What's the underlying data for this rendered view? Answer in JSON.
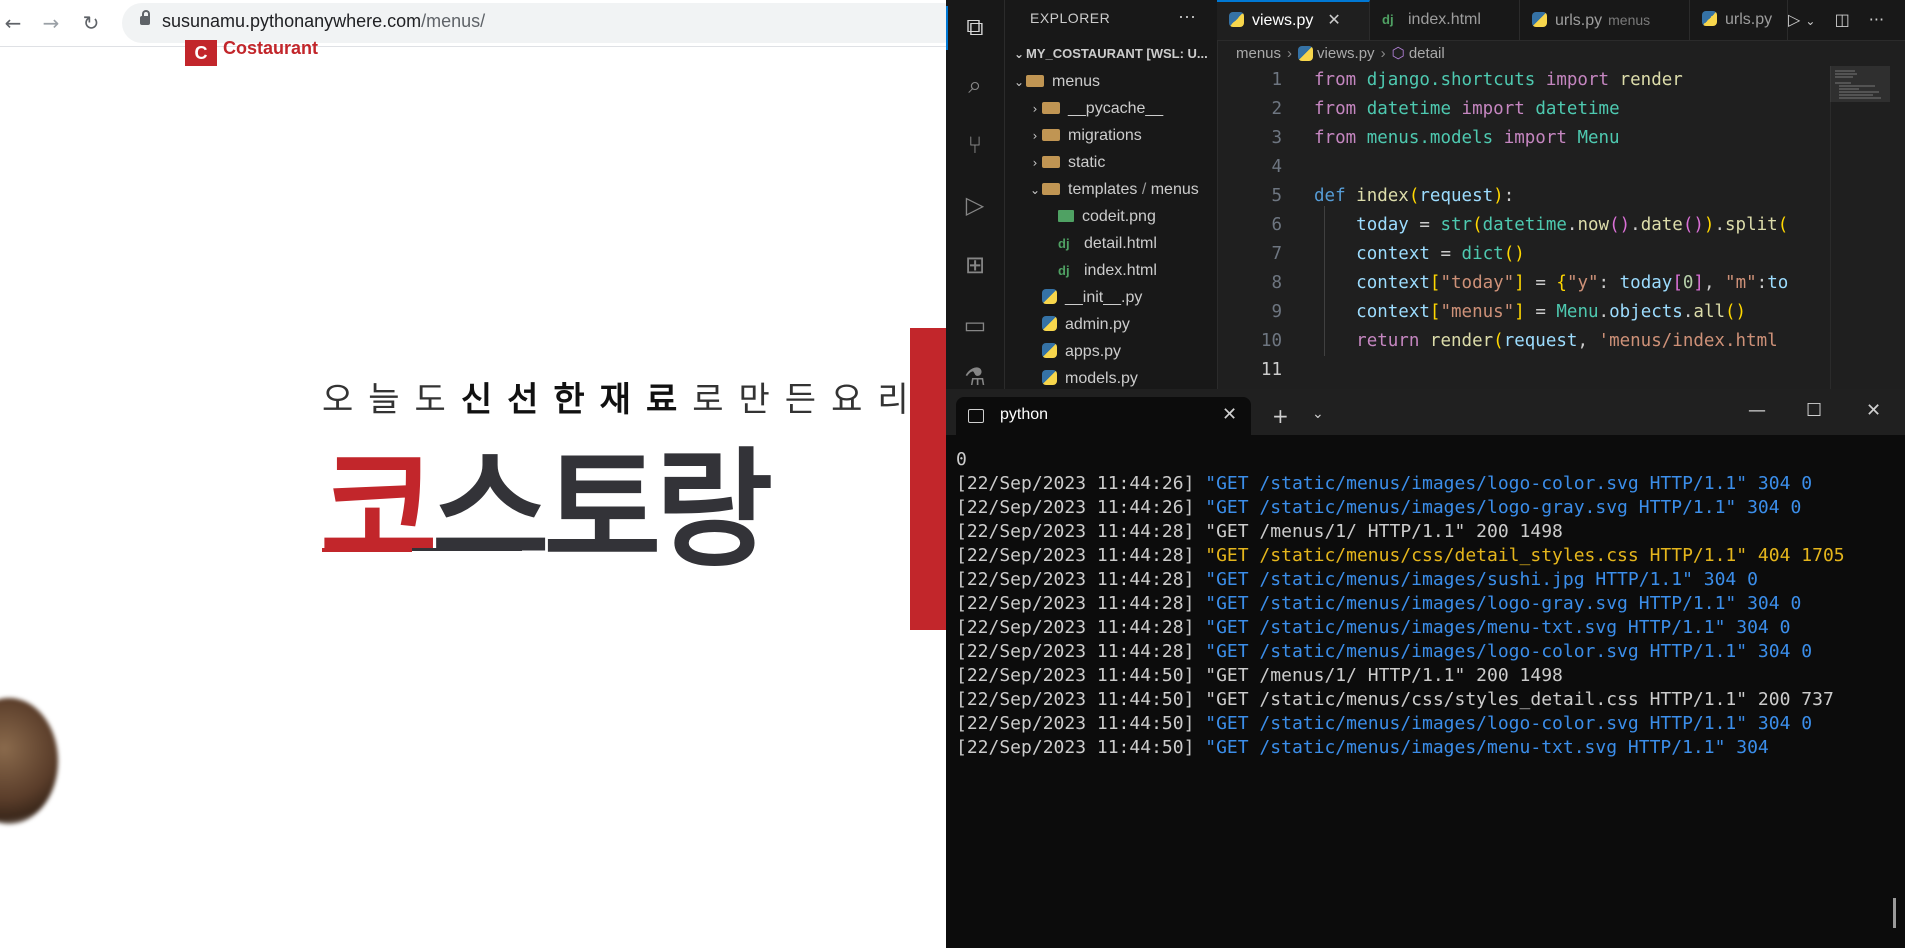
{
  "browser": {
    "nav": {
      "back": "←",
      "forward": "→",
      "reload": "↻"
    },
    "url_host": "susunamu.pythonanywhere.com",
    "url_path": "/menus/",
    "page": {
      "logo_mark": "C",
      "logo_word": "Costaurant",
      "tagline_light_1": "오늘도",
      "tagline_bold": "신선한재료",
      "tagline_light_2": "로만든요리",
      "hero_first": "코",
      "hero_rest": "스토랑"
    }
  },
  "vscode": {
    "explorer_title": "EXPLORER",
    "explorer_more": "···",
    "workspace": "MY_COSTAURANT [WSL: U...",
    "tree": [
      {
        "label": "menus",
        "kind": "folder",
        "open": true,
        "depth": 0
      },
      {
        "label": "__pycache__",
        "kind": "folder",
        "open": false,
        "depth": 1
      },
      {
        "label": "migrations",
        "kind": "folder",
        "open": false,
        "depth": 1
      },
      {
        "label": "static",
        "kind": "folder",
        "open": false,
        "depth": 1
      },
      {
        "label": "templates",
        "label_suffix": "menus",
        "kind": "folder",
        "open": true,
        "depth": 1
      },
      {
        "label": "codeit.png",
        "kind": "png",
        "depth": 2
      },
      {
        "label": "detail.html",
        "kind": "dj",
        "depth": 2
      },
      {
        "label": "index.html",
        "kind": "dj",
        "depth": 2
      },
      {
        "label": "__init__.py",
        "kind": "py",
        "depth": 1
      },
      {
        "label": "admin.py",
        "kind": "py",
        "depth": 1
      },
      {
        "label": "apps.py",
        "kind": "py",
        "depth": 1
      },
      {
        "label": "models.py",
        "kind": "py",
        "depth": 1
      }
    ],
    "tabs": [
      {
        "label": "views.py",
        "desc": "",
        "icon": "python-icon",
        "active": true
      },
      {
        "label": "index.html",
        "desc": "",
        "icon": "django-icon",
        "active": false
      },
      {
        "label": "urls.py",
        "desc": "menus",
        "icon": "python-icon",
        "active": false
      },
      {
        "label": "urls.py",
        "desc": "",
        "icon": "python-icon",
        "active": false
      }
    ],
    "tab_close": "✕",
    "breadcrumbs": {
      "folder": "menus",
      "file": "views.py",
      "symbol": "detail"
    },
    "code_lines": [
      [
        [
          "k-kw",
          "from"
        ],
        [
          "k-plain",
          " "
        ],
        [
          "k-cls",
          "django.shortcuts"
        ],
        [
          "k-plain",
          " "
        ],
        [
          "k-kw",
          "import"
        ],
        [
          "k-plain",
          " "
        ],
        [
          "k-fn",
          "render"
        ]
      ],
      [
        [
          "k-kw",
          "from"
        ],
        [
          "k-plain",
          " "
        ],
        [
          "k-cls",
          "datetime"
        ],
        [
          "k-plain",
          " "
        ],
        [
          "k-kw",
          "import"
        ],
        [
          "k-plain",
          " "
        ],
        [
          "k-cls",
          "datetime"
        ]
      ],
      [
        [
          "k-kw",
          "from"
        ],
        [
          "k-plain",
          " "
        ],
        [
          "k-cls",
          "menus.models"
        ],
        [
          "k-plain",
          " "
        ],
        [
          "k-kw",
          "import"
        ],
        [
          "k-plain",
          " "
        ],
        [
          "k-cls",
          "Menu"
        ]
      ],
      [],
      [
        [
          "k-def",
          "def"
        ],
        [
          "k-plain",
          " "
        ],
        [
          "k-fn",
          "index"
        ],
        [
          "k-br1",
          "("
        ],
        [
          "k-var",
          "request"
        ],
        [
          "k-br1",
          ")"
        ],
        [
          "k-plain",
          ":"
        ]
      ],
      [
        [
          "k-plain",
          "    "
        ],
        [
          "k-var",
          "today"
        ],
        [
          "k-plain",
          " = "
        ],
        [
          "k-cls",
          "str"
        ],
        [
          "k-br1",
          "("
        ],
        [
          "k-cls",
          "datetime"
        ],
        [
          "k-plain",
          "."
        ],
        [
          "k-fn",
          "now"
        ],
        [
          "k-br2",
          "()"
        ],
        [
          "k-plain",
          "."
        ],
        [
          "k-fn",
          "date"
        ],
        [
          "k-br2",
          "()"
        ],
        [
          "k-br1",
          ")"
        ],
        [
          "k-plain",
          "."
        ],
        [
          "k-fn",
          "split"
        ],
        [
          "k-br1",
          "("
        ]
      ],
      [
        [
          "k-plain",
          "    "
        ],
        [
          "k-var",
          "context"
        ],
        [
          "k-plain",
          " = "
        ],
        [
          "k-cls",
          "dict"
        ],
        [
          "k-br1",
          "()"
        ]
      ],
      [
        [
          "k-plain",
          "    "
        ],
        [
          "k-var",
          "context"
        ],
        [
          "k-br1",
          "["
        ],
        [
          "k-str",
          "\"today\""
        ],
        [
          "k-br1",
          "]"
        ],
        [
          "k-plain",
          " = "
        ],
        [
          "k-br1",
          "{"
        ],
        [
          "k-str",
          "\"y\""
        ],
        [
          "k-plain",
          ": "
        ],
        [
          "k-var",
          "today"
        ],
        [
          "k-br2",
          "["
        ],
        [
          "k-num",
          "0"
        ],
        [
          "k-br2",
          "]"
        ],
        [
          "k-plain",
          ", "
        ],
        [
          "k-str",
          "\"m\""
        ],
        [
          "k-plain",
          ":"
        ],
        [
          "k-var",
          "to"
        ]
      ],
      [
        [
          "k-plain",
          "    "
        ],
        [
          "k-var",
          "context"
        ],
        [
          "k-br1",
          "["
        ],
        [
          "k-str",
          "\"menus\""
        ],
        [
          "k-br1",
          "]"
        ],
        [
          "k-plain",
          " = "
        ],
        [
          "k-cls",
          "Menu"
        ],
        [
          "k-plain",
          "."
        ],
        [
          "k-var",
          "objects"
        ],
        [
          "k-plain",
          "."
        ],
        [
          "k-fn",
          "all"
        ],
        [
          "k-br1",
          "()"
        ]
      ],
      [
        [
          "k-plain",
          "    "
        ],
        [
          "k-kw",
          "return"
        ],
        [
          "k-plain",
          " "
        ],
        [
          "k-fn",
          "render"
        ],
        [
          "k-br1",
          "("
        ],
        [
          "k-var",
          "request"
        ],
        [
          "k-plain",
          ", "
        ],
        [
          "k-str",
          "'menus/index.html"
        ]
      ],
      []
    ]
  },
  "terminal": {
    "tab_title": "python",
    "tab_close": "✕",
    "new_tab": "+",
    "dropdown": "⌄",
    "win_min": "—",
    "win_max": "☐",
    "win_close": "✕",
    "lines": [
      {
        "ts": "0",
        "req": "",
        "color": "plain"
      },
      {
        "ts": "[22/Sep/2023 11:44:26] ",
        "req": "\"GET /static/menus/images/logo-color.svg HTTP/1.1\" 304 0",
        "color": "blue"
      },
      {
        "ts": "[22/Sep/2023 11:44:26] ",
        "req": "\"GET /static/menus/images/logo-gray.svg HTTP/1.1\" 304 0",
        "color": "blue"
      },
      {
        "ts": "[22/Sep/2023 11:44:28] ",
        "req": "\"GET /menus/1/ HTTP/1.1\" 200 1498",
        "color": "plain"
      },
      {
        "ts": "[22/Sep/2023 11:44:28] ",
        "req": "\"GET /static/menus/css/detail_styles.css HTTP/1.1\" 404 1705",
        "color": "yellow"
      },
      {
        "ts": "[22/Sep/2023 11:44:28] ",
        "req": "\"GET /static/menus/images/sushi.jpg HTTP/1.1\" 304 0",
        "color": "blue"
      },
      {
        "ts": "[22/Sep/2023 11:44:28] ",
        "req": "\"GET /static/menus/images/logo-gray.svg HTTP/1.1\" 304 0",
        "color": "blue"
      },
      {
        "ts": "[22/Sep/2023 11:44:28] ",
        "req": "\"GET /static/menus/images/menu-txt.svg HTTP/1.1\" 304 0",
        "color": "blue"
      },
      {
        "ts": "[22/Sep/2023 11:44:28] ",
        "req": "\"GET /static/menus/images/logo-color.svg HTTP/1.1\" 304 0",
        "color": "blue"
      },
      {
        "ts": "[22/Sep/2023 11:44:50] ",
        "req": "\"GET /menus/1/ HTTP/1.1\" 200 1498",
        "color": "plain"
      },
      {
        "ts": "[22/Sep/2023 11:44:50] ",
        "req": "\"GET /static/menus/css/styles_detail.css HTTP/1.1\" 200 737",
        "color": "plain"
      },
      {
        "ts": "[22/Sep/2023 11:44:50] ",
        "req": "\"GET /static/menus/images/logo-color.svg HTTP/1.1\" 304 0",
        "color": "blue"
      },
      {
        "ts": "[22/Sep/2023 11:44:50] ",
        "req": "\"GET /static/menus/images/menu-txt.svg HTTP/1.1\" 304",
        "color": "blue"
      }
    ]
  },
  "colors": {
    "brand_red": "#c2262b",
    "vscode_accent": "#0078d4",
    "terminal_blue": "#3b8eea",
    "terminal_yellow": "#e5b61c"
  }
}
